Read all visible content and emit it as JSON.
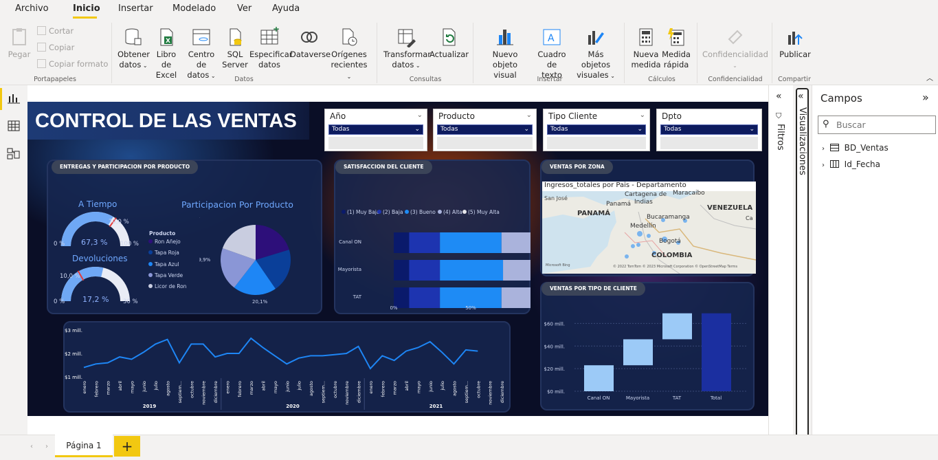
{
  "menu": {
    "tabs": [
      "Archivo",
      "Inicio",
      "Insertar",
      "Modelado",
      "Ver",
      "Ayuda"
    ]
  },
  "ribbon": {
    "clipboard": {
      "paste": "Pegar",
      "cut": "Cortar",
      "copy": "Copiar",
      "format": "Copiar formato",
      "group": "Portapapeles"
    },
    "data": {
      "get_data": "Obtener",
      "get_data2": "datos",
      "excel": "Libro de",
      "excel2": "Excel",
      "hub": "Centro de",
      "hub2": "datos",
      "sql": "SQL",
      "sql2": "Server",
      "enter": "Especificar",
      "enter2": "datos",
      "dataverse": "Dataverse",
      "recent": "Orígenes",
      "recent2": "recientes",
      "group": "Datos"
    },
    "queries": {
      "transform": "Transformar",
      "transform2": "datos",
      "refresh": "Actualizar",
      "group": "Consultas"
    },
    "insert": {
      "visual": "Nuevo objeto",
      "visual2": "visual",
      "textbox": "Cuadro de",
      "textbox2": "texto",
      "more": "Más objetos",
      "more2": "visuales",
      "group": "Insertar"
    },
    "calc": {
      "measure": "Nueva",
      "measure2": "medida",
      "quick": "Medida",
      "quick2": "rápida",
      "group": "Cálculos"
    },
    "sens": {
      "label": "Confidencialidad",
      "group": "Confidencialidad"
    },
    "share": {
      "publish": "Publicar",
      "group": "Compartir"
    }
  },
  "report": {
    "title": "CONTROL DE LAS VENTAS",
    "slicers": [
      {
        "label": "Año",
        "value": "Todas"
      },
      {
        "label": "Producto",
        "value": "Todas"
      },
      {
        "label": "Tipo Cliente",
        "value": "Todas"
      },
      {
        "label": "Dpto",
        "value": "Todas"
      }
    ],
    "panel1": {
      "title": "ENTREGAS Y PARTICIPACION POR PRODUCTO",
      "gauge1": {
        "title": "A Tiempo",
        "value": 67.3,
        "value_label": "67,3 %",
        "target_label": "70,0 %",
        "min": "0 %",
        "max": "100 %"
      },
      "gauge2": {
        "title": "Devoluciones",
        "value": 17.2,
        "value_label": "17,2 %",
        "target_label": "10,0 %",
        "min": "0 %",
        "max": "30 %"
      },
      "legend_title": "Producto",
      "pie_title": "Participacion Por Producto"
    },
    "panel2": {
      "title": "SATISFACCION DEL CLIENTE"
    },
    "panel3": {
      "title": "VENTAS POR ZONA",
      "map_title": "Ingresos_totales por Pais - Departamento",
      "places": [
        "San José",
        "Panamá",
        "Cartagena de",
        "Indias",
        "Maracaibo",
        "VENEZUELA",
        "PANAMÁ",
        "Bucaramanga",
        "Medellín",
        "Bogotá",
        "COLOMBIA",
        "Ca"
      ],
      "credit": "© 2022 TomTom © 2023 Microsoft Corporation © OpenStreetMap Terms",
      "brand": "Microsoft Bing"
    },
    "panel4": {
      "title": "VENTAS POR TIPO DE CLIENTE"
    }
  },
  "chart_data": [
    {
      "type": "pie",
      "title": "Participacion Por Producto",
      "series": [
        {
          "name": "Ron Añejo",
          "value": 20.3,
          "label": "20,3%",
          "color": "#2d0f7a"
        },
        {
          "name": "Tapa Roja",
          "value": 20.1,
          "label": "20,1%",
          "color": "#0a3f99"
        },
        {
          "name": "Tapa Azul",
          "value": 20.1,
          "label": "20,1%",
          "color": "#1e86f5"
        },
        {
          "name": "Tapa Verde",
          "value": 19.9,
          "label": "19,9%",
          "color": "#8a96d6"
        },
        {
          "name": "Licor de Ron",
          "value": 19.6,
          "label": "19,6%",
          "color": "#c9cde0"
        }
      ]
    },
    {
      "type": "bar",
      "stacked": true,
      "orientation": "horizontal",
      "title": "",
      "categories": [
        "Canal ON",
        "Mayorista",
        "TAT"
      ],
      "series": [
        {
          "name": "(1) Muy Baja",
          "values": [
            10,
            10,
            10
          ],
          "color": "#0a1a6b"
        },
        {
          "name": "(2) Baja",
          "values": [
            20,
            20,
            20
          ],
          "color": "#1d34b0"
        },
        {
          "name": "(3) Bueno",
          "values": [
            40,
            41,
            40
          ],
          "color": "#1e8bf5"
        },
        {
          "name": "(4) Alta",
          "values": [
            21,
            20,
            21
          ],
          "color": "#aab3dc"
        },
        {
          "name": "(5) Muy Alta",
          "values": [
            9,
            9,
            9
          ],
          "color": "#e6e6ea"
        }
      ],
      "xticks": [
        "0%",
        "50%",
        "100%"
      ]
    },
    {
      "type": "line",
      "title": "",
      "yticks": [
        "$1 mill.",
        "$2 mill.",
        "$3 mill."
      ],
      "ylim": [
        1,
        3
      ],
      "years": [
        "2019",
        "2020",
        "2021"
      ],
      "months": [
        "enero",
        "febrero",
        "marzo",
        "abril",
        "mayo",
        "junio",
        "julio",
        "agosto",
        "septiem...",
        "octubre",
        "noviembre",
        "diciembre"
      ],
      "values": [
        1.4,
        1.55,
        1.6,
        1.85,
        1.75,
        2.05,
        2.4,
        2.6,
        1.6,
        2.4,
        2.4,
        1.85,
        2.0,
        2.0,
        2.65,
        2.25,
        1.9,
        1.55,
        1.8,
        1.9,
        1.9,
        1.95,
        2.0,
        2.3,
        1.35,
        1.9,
        1.7,
        2.1,
        2.25,
        2.5,
        2.05,
        1.55,
        2.15,
        2.1
      ],
      "color": "#1e86f5"
    },
    {
      "type": "bar",
      "subtype": "waterfall",
      "title": "",
      "categories": [
        "Canal ON",
        "Mayorista",
        "Total"
      ],
      "steps": [
        {
          "name": "Canal ON",
          "start": 0,
          "end": 23
        },
        {
          "name": "Mayorista",
          "start": 23,
          "end": 46
        },
        {
          "name": "TAT",
          "start": 46,
          "end": 69
        },
        {
          "name": "Total",
          "start": 0,
          "end": 69
        }
      ],
      "all_categories": [
        "Canal ON",
        "Mayorista",
        "TAT",
        "Total"
      ],
      "yticks": [
        "$0 mill.",
        "$20 mill.",
        "$40 mill.",
        "$60 mill."
      ],
      "ylim": [
        0,
        70
      ]
    }
  ],
  "panes": {
    "filters": "Filtros",
    "viz": "Visualizaciones",
    "fields_title": "Campos",
    "search_placeholder": "Buscar",
    "tables": [
      "BD_Ventas",
      "Id_Fecha"
    ]
  },
  "pages": {
    "tab": "Página 1",
    "add": "+"
  }
}
